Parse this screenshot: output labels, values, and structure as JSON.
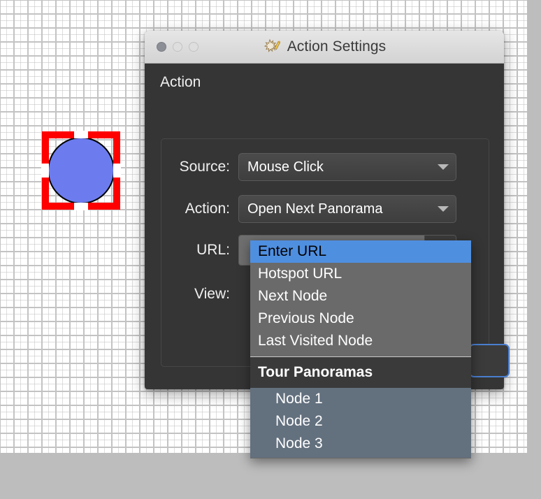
{
  "canvas": {
    "hotspot": {
      "name": "circle-hotspot",
      "shape": "circle",
      "fill_color": "#6c7cef",
      "stroke_color": "#000000",
      "selection_color": "#fe0000"
    },
    "grid_color": "#c3c3c3",
    "background_color": "#ffffff",
    "outer_background_color": "#bdbdbd"
  },
  "window": {
    "title": "Action Settings",
    "app_icon": "maple-leaf-pencil-icon",
    "traffic_lights": [
      "close-button",
      "minimize-button",
      "zoom-button"
    ]
  },
  "dialog": {
    "section_title": "Action",
    "fields": [
      {
        "label": "Source:",
        "value": "Mouse Click",
        "type": "combobox"
      },
      {
        "label": "Action:",
        "value": "Open Next Panorama",
        "type": "combobox"
      },
      {
        "label": "URL:",
        "value": "",
        "type": "editable-combobox"
      },
      {
        "label": "View:",
        "value": "",
        "type": "label-only"
      }
    ],
    "shuffle_button": {
      "icon": "shuffle-icon",
      "label": ""
    },
    "ok_button": {
      "label": "",
      "accent_color": "#4a7fd0"
    }
  },
  "dropdown": {
    "open": true,
    "selected": "Enter URL",
    "items": [
      "Enter URL",
      "Hotspot URL",
      "Next Node",
      "Previous Node",
      "Last Visited Node"
    ],
    "group": {
      "header": "Tour Panoramas",
      "items": [
        "Node 1",
        "Node 2",
        "Node 3"
      ]
    },
    "highlight_color": "#4f8fe0",
    "background_color": "#6a6a6a",
    "group_background_color": "#63707e"
  }
}
